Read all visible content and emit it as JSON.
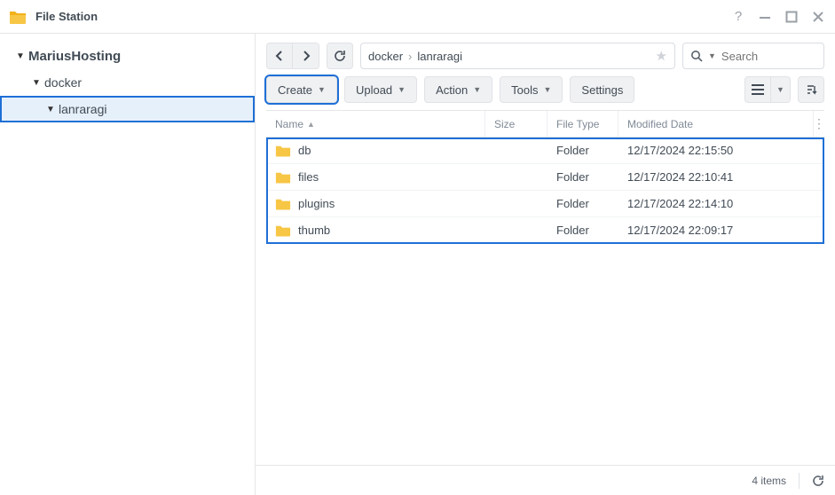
{
  "app": {
    "title": "File Station"
  },
  "tree": {
    "root": "MariusHosting",
    "child": "docker",
    "grandchild": "lanraragi"
  },
  "breadcrumb": {
    "p0": "docker",
    "p1": "lanraragi"
  },
  "search": {
    "placeholder": "Search"
  },
  "toolbar": {
    "create": "Create",
    "upload": "Upload",
    "action": "Action",
    "tools": "Tools",
    "settings": "Settings"
  },
  "columns": {
    "name": "Name",
    "size": "Size",
    "type": "File Type",
    "modified": "Modified Date"
  },
  "rows": [
    {
      "name": "db",
      "size": "",
      "type": "Folder",
      "modified": "12/17/2024 22:15:50"
    },
    {
      "name": "files",
      "size": "",
      "type": "Folder",
      "modified": "12/17/2024 22:10:41"
    },
    {
      "name": "plugins",
      "size": "",
      "type": "Folder",
      "modified": "12/17/2024 22:14:10"
    },
    {
      "name": "thumb",
      "size": "",
      "type": "Folder",
      "modified": "12/17/2024 22:09:17"
    }
  ],
  "status": {
    "count": "4 items"
  }
}
